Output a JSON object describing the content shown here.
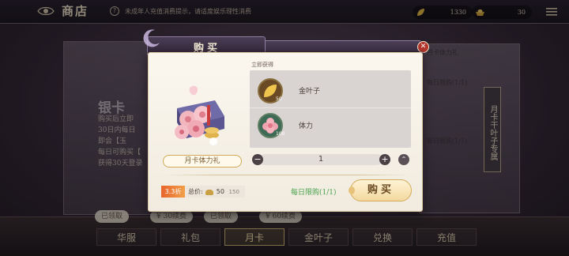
{
  "top_bar": {
    "title": "商店",
    "notice": "未成年人充值消费提示，请适度娱乐理性消费",
    "currency": [
      {
        "icon": "gold-leaf-icon",
        "amount": "1330"
      },
      {
        "icon": "ingot-icon",
        "amount": "30"
      }
    ]
  },
  "background": {
    "left_card_title": "银卡",
    "left_card_lines": [
      "购买后立即",
      "30日内每日",
      "即会【玉",
      "每日可购买【",
      "获得30天登录"
    ],
    "right_card_lines": [
      "月卡体力礼",
      "每日限购(1/1)",
      "每日限购(1/1)"
    ],
    "right_scroll_label": "月卡干叶子专属",
    "shelf_tags": [
      "已领取",
      "¥ 30续费",
      "已领取",
      "¥ 60续费"
    ]
  },
  "tabs": [
    {
      "label": "华服",
      "active": false
    },
    {
      "label": "礼包",
      "active": false
    },
    {
      "label": "月卡",
      "active": true
    },
    {
      "label": "金叶子",
      "active": false
    },
    {
      "label": "兑换",
      "active": false
    },
    {
      "label": "充值",
      "active": false
    }
  ],
  "modal": {
    "title": "购买",
    "item_name": "月卡体力礼",
    "obtain_label": "立即获得",
    "rewards": [
      {
        "name": "金叶子",
        "count": "50",
        "icon": "gold-leaf-icon"
      },
      {
        "name": "体力",
        "count": "100",
        "icon": "stamina-flower-icon"
      }
    ],
    "quantity": "1",
    "discount": "3.3折",
    "price_label": "总价:",
    "price_now": "50",
    "price_old": "150",
    "daily_limit": "每日限购(1/1)",
    "buy_label": "购买"
  },
  "colors": {
    "accent_gold": "#d3ac5e",
    "discount": "#e8642b",
    "limit_green": "#49a24d",
    "close_red": "#b3362c"
  }
}
